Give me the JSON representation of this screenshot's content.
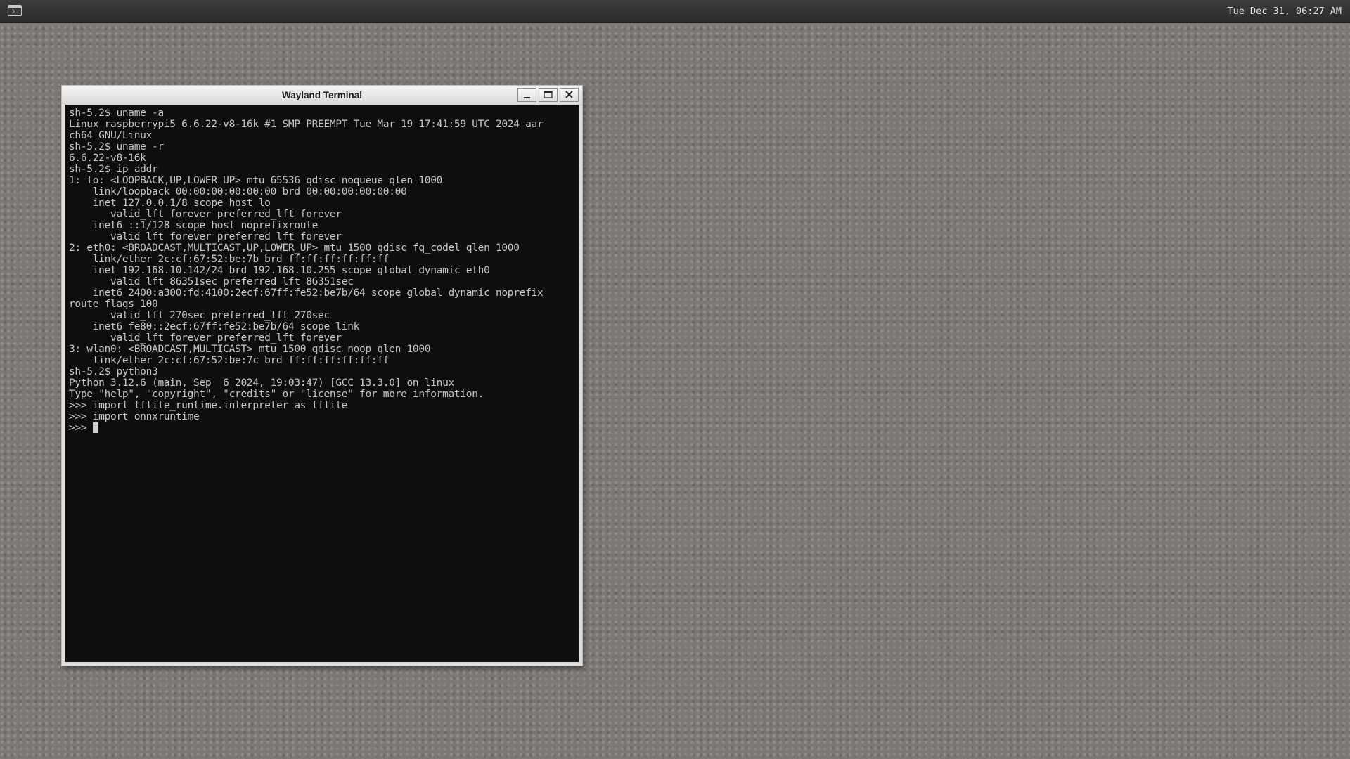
{
  "panel": {
    "launcher_icon": "terminal-icon",
    "clock": "Tue Dec 31, 06:27 AM"
  },
  "window": {
    "title": "Wayland Terminal",
    "buttons": {
      "minimize_icon": "minimize-icon",
      "maximize_icon": "maximize-icon",
      "close_icon": "close-icon"
    }
  },
  "terminal": {
    "lines": [
      "sh-5.2$ uname -a",
      "Linux raspberrypi5 6.6.22-v8-16k #1 SMP PREEMPT Tue Mar 19 17:41:59 UTC 2024 aar",
      "ch64 GNU/Linux",
      "sh-5.2$ uname -r",
      "6.6.22-v8-16k",
      "sh-5.2$ ip addr",
      "1: lo: <LOOPBACK,UP,LOWER_UP> mtu 65536 qdisc noqueue qlen 1000",
      "    link/loopback 00:00:00:00:00:00 brd 00:00:00:00:00:00",
      "    inet 127.0.0.1/8 scope host lo",
      "       valid_lft forever preferred_lft forever",
      "    inet6 ::1/128 scope host noprefixroute",
      "       valid_lft forever preferred_lft forever",
      "2: eth0: <BROADCAST,MULTICAST,UP,LOWER_UP> mtu 1500 qdisc fq_codel qlen 1000",
      "    link/ether 2c:cf:67:52:be:7b brd ff:ff:ff:ff:ff:ff",
      "    inet 192.168.10.142/24 brd 192.168.10.255 scope global dynamic eth0",
      "       valid_lft 86351sec preferred_lft 86351sec",
      "    inet6 2400:a300:fd:4100:2ecf:67ff:fe52:be7b/64 scope global dynamic noprefix",
      "route flags 100",
      "       valid_lft 270sec preferred_lft 270sec",
      "    inet6 fe80::2ecf:67ff:fe52:be7b/64 scope link",
      "       valid_lft forever preferred_lft forever",
      "3: wlan0: <BROADCAST,MULTICAST> mtu 1500 qdisc noop qlen 1000",
      "    link/ether 2c:cf:67:52:be:7c brd ff:ff:ff:ff:ff:ff",
      "sh-5.2$ python3",
      "Python 3.12.6 (main, Sep  6 2024, 19:03:47) [GCC 13.3.0] on linux",
      "Type \"help\", \"copyright\", \"credits\" or \"license\" for more information.",
      ">>> import tflite_runtime.interpreter as tflite",
      ">>> import onnxruntime"
    ],
    "prompt": ">>> "
  }
}
